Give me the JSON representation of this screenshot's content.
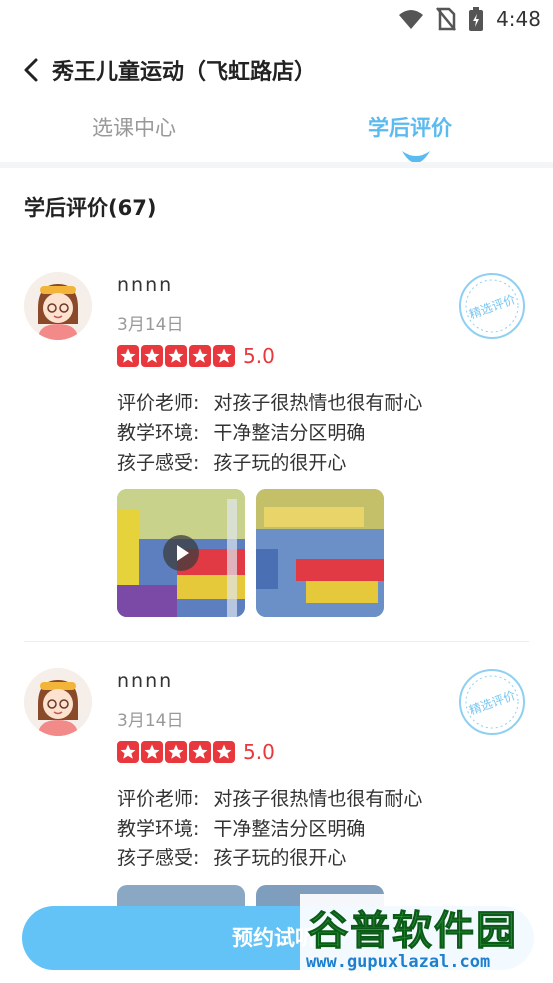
{
  "status_bar": {
    "time": "4:48"
  },
  "header": {
    "title": "秀王儿童运动（飞虹路店）"
  },
  "tabs": [
    {
      "label": "选课中心",
      "active": false
    },
    {
      "label": "学后评价",
      "active": true
    }
  ],
  "section": {
    "title": "学后评价(67)"
  },
  "reviews": [
    {
      "user": "nnnn",
      "date": "3月14日",
      "rating": 5,
      "score": "5.0",
      "badge": "精选评价",
      "lines": [
        {
          "label": "评价老师:",
          "text": "对孩子很热情也很有耐心"
        },
        {
          "label": "教学环境:",
          "text": "干净整洁分区明确"
        },
        {
          "label": "孩子感受:",
          "text": "孩子玩的很开心"
        }
      ]
    },
    {
      "user": "nnnn",
      "date": "3月14日",
      "rating": 5,
      "score": "5.0",
      "badge": "精选评价",
      "lines": [
        {
          "label": "评价老师:",
          "text": "对孩子很热情也很有耐心"
        },
        {
          "label": "教学环境:",
          "text": "干净整洁分区明确"
        },
        {
          "label": "孩子感受:",
          "text": "孩子玩的很开心"
        }
      ]
    }
  ],
  "cta": {
    "label": "预约试听"
  },
  "watermark": {
    "title": "谷普软件园",
    "url": "www.gupuxlazal.com"
  },
  "colors": {
    "accent": "#5bbbf0",
    "star": "#e8383d",
    "cta": "#63c3f6"
  }
}
